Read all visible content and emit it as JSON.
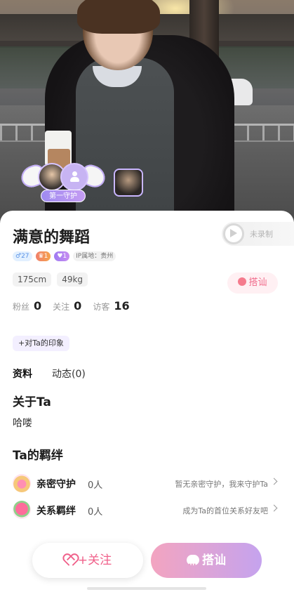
{
  "hero": {
    "guard_label": "第一守护"
  },
  "profile": {
    "name": "满意的舞蹈",
    "record_label": "未录制",
    "badges": {
      "gender_age": "♂27",
      "level": "♛1",
      "heart": "♥1",
      "ip": "IP属地：贵州"
    },
    "tags": [
      "175cm",
      "49kg"
    ],
    "chat_small_label": "搭讪",
    "stats": [
      {
        "label": "粉丝",
        "value": "0"
      },
      {
        "label": "关注",
        "value": "0"
      },
      {
        "label": "访客",
        "value": "16"
      }
    ],
    "impression_label": "+对Ta的印象"
  },
  "tabs": [
    {
      "label": "资料",
      "active": true
    },
    {
      "label": "动态(0)",
      "active": false
    }
  ],
  "about": {
    "title": "关于Ta",
    "text": "哈喽"
  },
  "bonds": {
    "title": "Ta的羁绊",
    "rows": [
      {
        "title": "亲密守护",
        "count": "0人",
        "hint": "暂无亲密守护，我来守护Ta",
        "icon": "guardian-heart-icon"
      },
      {
        "title": "关系羁绊",
        "count": "0人",
        "hint": "成为Ta的首位关系好友吧",
        "icon": "rose-icon"
      }
    ]
  },
  "actions": {
    "follow_label": "+关注",
    "chat_label": "搭讪"
  },
  "colors": {
    "accent_pink": "#f0608a",
    "accent_purple": "#c5a3ee"
  }
}
